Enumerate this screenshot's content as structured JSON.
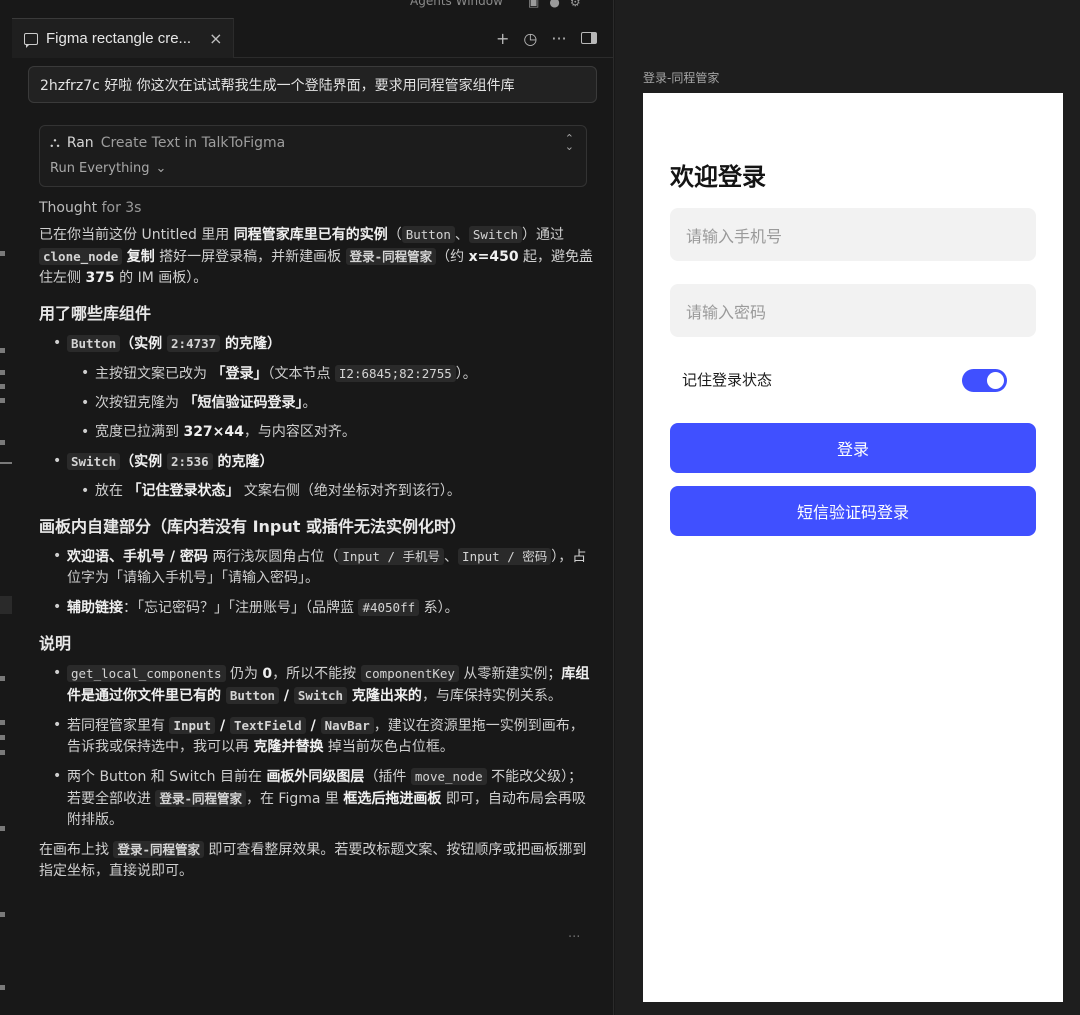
{
  "top_strip": {
    "label": "Agents Window"
  },
  "tab": {
    "title": "Figma rectangle cre...",
    "close": "×"
  },
  "tab_actions": {
    "add": "+",
    "history": "◷",
    "more": "···"
  },
  "prompt": "2hzfrz7c 好啦 你这次在试试帮我生成一个登陆界面，要求用同程管家组件库",
  "tool_call": {
    "status": "Ran",
    "name": "Create Text in TalkToFigma",
    "mode": "Run Everything"
  },
  "thought": {
    "prefix": "Thought",
    "duration": "for 3s"
  },
  "message": {
    "intro": [
      "已在你当前这份 Untitled 里用 ",
      "同程管家库里已有的实例",
      "（",
      "Button",
      "、",
      "Switch",
      "）通过 ",
      "clone_node",
      " ",
      "复制",
      " 搭好一屏登录稿，并新建画板 ",
      "登录-同程管家",
      "（约 ",
      "x=450",
      " 起，避免盖住左侧 ",
      "375",
      " 的 IM 画板）。"
    ],
    "h_used": "用了哪些库组件",
    "button_item": [
      "Button",
      "（实例 ",
      "2:4737",
      " 的克隆）"
    ],
    "button_sub": [
      [
        "主按钮文案已改为 ",
        "「登录」",
        "（文本节点 ",
        "I2:6845;82:2755",
        "）。"
      ],
      [
        "次按钮克隆为 ",
        "「短信验证码登录」",
        "。"
      ],
      [
        "宽度已拉满到 ",
        "327×44",
        "，与内容区对齐。"
      ]
    ],
    "switch_item": [
      "Switch",
      "（实例 ",
      "2:536",
      " 的克隆）"
    ],
    "switch_sub": [
      "放在 ",
      "「记住登录状态」",
      " 文案右侧（绝对坐标对齐到该行）。"
    ],
    "h_self": "画板内自建部分（库内若没有 Input 或插件无法实例化时）",
    "self_items": [
      [
        "欢迎语、手机号 / 密码",
        " 两行浅灰圆角占位（",
        "Input / 手机号",
        "、",
        "Input / 密码",
        "），占位字为「请输入手机号」「请输入密码」。"
      ],
      [
        "辅助链接",
        "：「忘记密码？」「注册账号」（品牌蓝 ",
        "#4050ff",
        " 系）。"
      ]
    ],
    "h_note": "说明",
    "note_items": [
      [
        "get_local_components",
        " 仍为 ",
        "0",
        "，所以不能按 ",
        "componentKey",
        " 从零新建实例；",
        "库组件是通过你文件里已有的 ",
        "Button",
        " / ",
        "Switch",
        " 克隆出来的",
        "，与库保持实例关系。"
      ],
      [
        "若同程管家里有 ",
        "Input",
        " / ",
        "TextField",
        " / ",
        "NavBar",
        "，建议在资源里拖一实例到画布，告诉我或保持选中，我可以再 ",
        "克隆并替换",
        " 掉当前灰色占位框。"
      ],
      [
        "两个 Button 和 Switch 目前在 ",
        "画板外同级图层",
        "（插件 ",
        "move_node",
        " 不能改父级）；若要全部收进 ",
        "登录-同程管家",
        "，在 Figma 里 ",
        "框选后拖进画板",
        " 即可，自动布局会再吸附排版。"
      ]
    ],
    "outro": [
      "在画布上找 ",
      "登录-同程管家",
      " 即可查看整屏效果。若要改标题文案、按钮顺序或把画板挪到指定坐标，直接说即可。"
    ],
    "ellipsis": "···"
  },
  "canvas": {
    "frame_label": "登录-同程管家",
    "welcome": "欢迎登录",
    "phone_placeholder": "请输入手机号",
    "password_placeholder": "请输入密码",
    "remember_label": "记住登录状态",
    "switch_on": true,
    "primary_button": "登录",
    "secondary_button": "短信验证码登录"
  },
  "colors": {
    "brand": "#4050ff",
    "panel_bg": "#181818",
    "canvas_bg": "#1e1e1e"
  }
}
